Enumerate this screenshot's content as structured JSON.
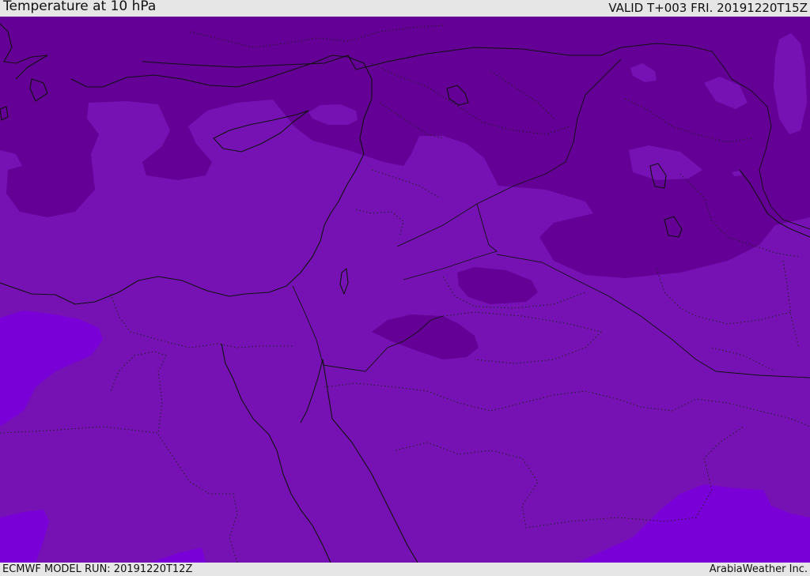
{
  "header": {
    "title": "Temperature at 10 hPa",
    "valid_time": "VALID T+003 FRI. 20191220T15Z"
  },
  "footer": {
    "model_run": "ECMWF MODEL RUN: 20191220T12Z",
    "publisher": "ArabiaWeather Inc."
  },
  "colors": {
    "base_field": "#7612b4",
    "cold_field": "#640096",
    "warm_field": "#7a00d8",
    "coastline": "#111111",
    "chrome": "#e6e6e6"
  }
}
